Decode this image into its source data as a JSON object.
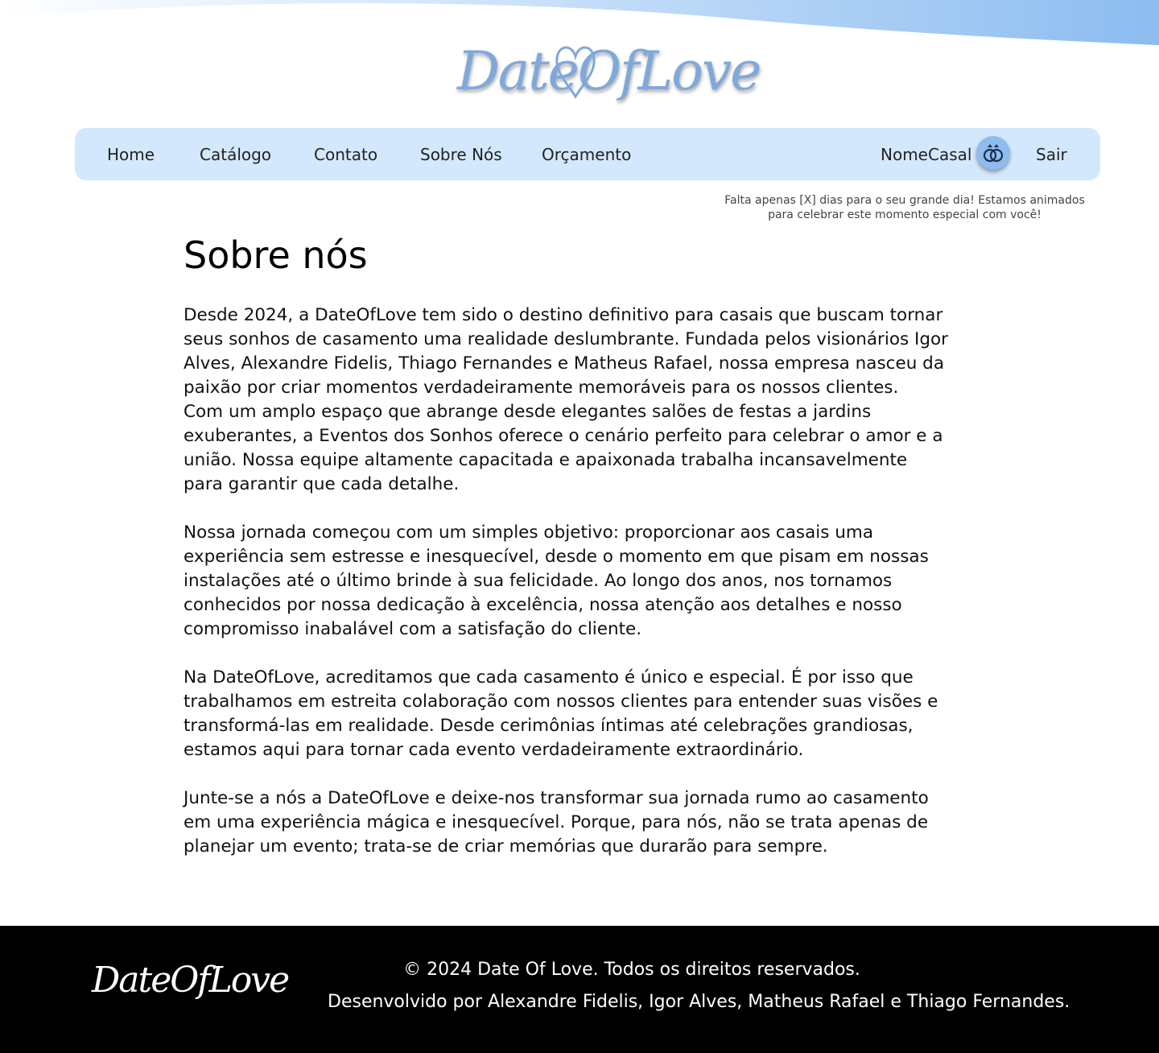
{
  "brand": {
    "logo_text": "DateOfLove",
    "footer_logo_text": "DateOfLove"
  },
  "nav": {
    "items": [
      {
        "label": "Home"
      },
      {
        "label": "Catálogo"
      },
      {
        "label": "Contato"
      },
      {
        "label": "Sobre Nós"
      },
      {
        "label": "Orçamento"
      }
    ],
    "couple_name": "NomeCasal",
    "rings_icon": "rings-icon",
    "logout_label": "Sair"
  },
  "countdown": {
    "line1": "Falta apenas [X] dias para o seu grande dia! Estamos animados",
    "line2": "para celebrar este momento especial com você!"
  },
  "main": {
    "title": "Sobre nós",
    "paragraphs": [
      [
        "Desde 2024, a DateOfLove tem sido o destino definitivo para casais que buscam tornar",
        "seus sonhos de casamento uma realidade deslumbrante. Fundada pelos visionários Igor",
        "Alves, Alexandre Fidelis, Thiago Fernandes e Matheus Rafael, nossa empresa nasceu da",
        "paixão por criar momentos verdadeiramente memoráveis para os nossos clientes.",
        "Com um amplo espaço que abrange desde elegantes salões de festas a jardins",
        "exuberantes, a Eventos dos Sonhos oferece o cenário perfeito para celebrar o amor e a",
        "união. Nossa equipe altamente capacitada e apaixonada trabalha incansavelmente",
        "para garantir que cada detalhe."
      ],
      [
        "Nossa jornada começou com um simples objetivo: proporcionar aos casais uma",
        "experiência sem estresse e inesquecível, desde o momento em que pisam em nossas",
        "instalações até o último brinde à sua felicidade. Ao longo dos anos, nos tornamos",
        "conhecidos por nossa dedicação à excelência, nossa atenção aos detalhes e nosso",
        "compromisso inabalável com a satisfação do cliente."
      ],
      [
        "Na DateOfLove, acreditamos que cada casamento é único e especial. É por isso que",
        "trabalhamos em estreita colaboração com nossos clientes para entender suas visões e",
        "transformá-las em realidade. Desde cerimônias íntimas até celebrações grandiosas,",
        "estamos aqui para tornar cada evento verdadeiramente extraordinário."
      ],
      [
        "Junte-se a nós a DateOfLove e deixe-nos transformar sua jornada rumo ao casamento",
        "em uma experiência mágica e inesquecível. Porque, para nós, não se trata apenas de",
        "planejar um evento; trata-se de criar memórias que durarão para sempre."
      ]
    ]
  },
  "footer": {
    "copyright": "© 2024 Date Of Love. Todos os direitos reservados.",
    "credits": "Desenvolvido por Alexandre Fidelis, Igor Alves, Matheus Rafael e Thiago Fernandes."
  },
  "colors": {
    "nav_bg": "#d3e8fd",
    "accent": "#8fbcef",
    "logo": "#7fa9da",
    "footer_bg": "#000000"
  }
}
